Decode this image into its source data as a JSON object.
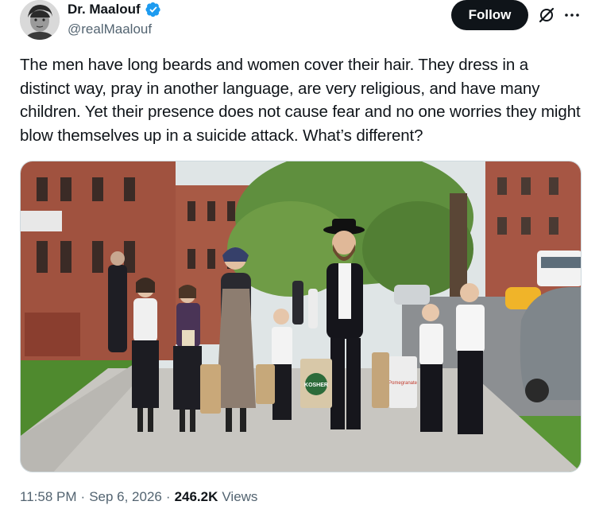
{
  "author": {
    "display_name": "Dr. Maalouf",
    "handle": "@realMaalouf",
    "verified": true,
    "verified_color": "#1d9bf0"
  },
  "actions": {
    "follow_label": "Follow",
    "grok_icon": "grok-icon",
    "more_icon": "more-options-icon"
  },
  "tweet": {
    "text": "The men have long beards and women cover their hair. They dress in a distinct way, pray in another language, are very religious, and have many children. Yet their presence does not cause fear and no one worries they might blow themselves up in a suicide attack. What’s different?"
  },
  "media": {
    "type": "photo",
    "bag_labels": [
      "KOSHER",
      "Pomegranate"
    ]
  },
  "meta": {
    "time": "11:58 PM",
    "sep1": "·",
    "date": "Sep 6, 2026",
    "sep2": "·",
    "views_count": "246.2K",
    "views_label": "Views"
  },
  "colors": {
    "text_primary": "#0f1419",
    "text_secondary": "#536471",
    "follow_bg": "#0f1419",
    "brand_blue": "#1d9bf0"
  }
}
